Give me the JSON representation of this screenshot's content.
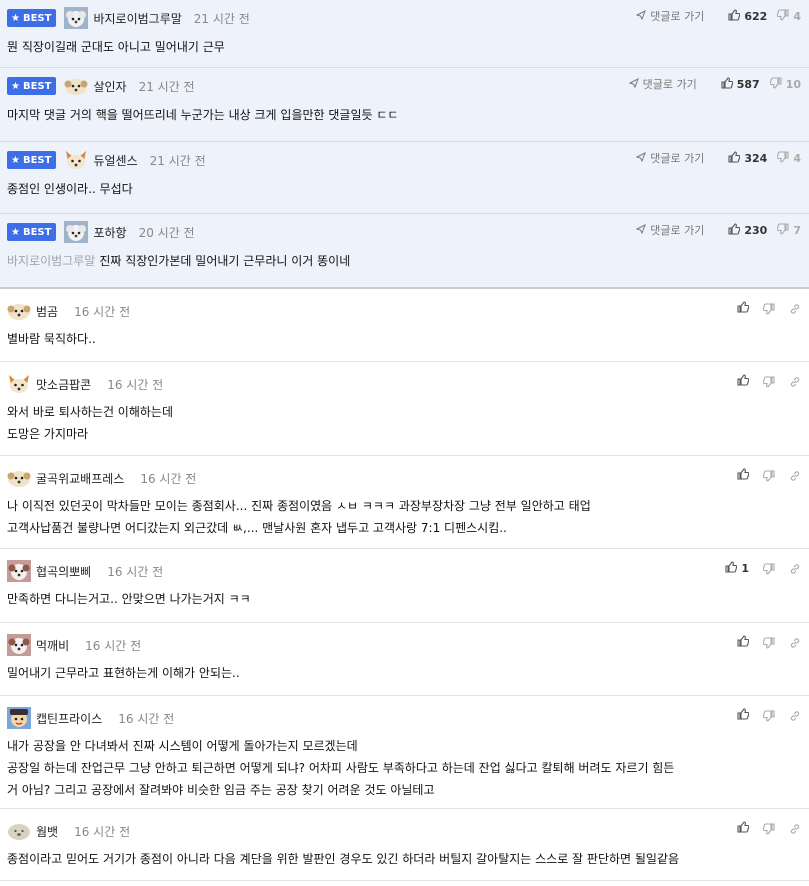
{
  "best_label": "BEST",
  "goto_label": "댓글로 가기",
  "best_comments": [
    {
      "nick": "바지로이범그루말",
      "avatar": "poodle",
      "time": "21 시간 전",
      "text": "뭔 직장이길래 군대도 아니고 밀어내기 근무",
      "reply_to": "",
      "up": "622",
      "down": "4"
    },
    {
      "nick": "살인자",
      "avatar": "beige",
      "time": "21 시간 전",
      "text": "마지막 댓글 거의 핵을 떨어뜨리네 누군가는 내상 크게 입을만한 댓글일듯 ㄷㄷ",
      "reply_to": "",
      "up": "587",
      "down": "10"
    },
    {
      "nick": "듀얼센스",
      "avatar": "fox",
      "time": "21 시간 전",
      "text": "종점인 인생이라.. 무섭다",
      "reply_to": "",
      "up": "324",
      "down": "4"
    },
    {
      "nick": "포하항",
      "avatar": "poodle",
      "time": "20 시간 전",
      "text": "진짜 직장인가본데 밀어내기 근무라니 이거 똥이네",
      "reply_to": "바지로이범그루말",
      "up": "230",
      "down": "7"
    }
  ],
  "comments": [
    {
      "nick": "범곰",
      "avatar": "beige",
      "time": "16 시간 전",
      "lines": [
        "별바람 묵직하다.."
      ],
      "up": ""
    },
    {
      "nick": "맛소금팝콘",
      "avatar": "fox",
      "time": "16 시간 전",
      "lines": [
        "와서 바로 퇴사하는건 이해하는데",
        "도망은 가지마라"
      ],
      "up": ""
    },
    {
      "nick": "굴곡위교배프레스",
      "avatar": "beige",
      "time": "16 시간 전",
      "lines": [
        "나 이직전 있던곳이 막차들만 모이는 종점회사... 진짜 종점이였음 ㅅㅂ ㅋㅋㅋ 과장부장차장 그냥 전부 일안하고 태업",
        "고객사납품건 불량나면 어디갔는지 외근갔데 ㅄ,... 맨날사원 혼자 냅두고 고객사랑 7:1 디펜스시킴.."
      ],
      "up": ""
    },
    {
      "nick": "협곡의뽀삐",
      "avatar": "dog",
      "time": "16 시간 전",
      "lines": [
        "만족하면 다니는거고.. 안맞으면 나가는거지 ㅋㅋ"
      ],
      "up": "1"
    },
    {
      "nick": "먹깨비",
      "avatar": "dog",
      "time": "16 시간 전",
      "lines": [
        "밀어내기 근무라고 표현하는게 이해가 안되는.."
      ],
      "up": ""
    },
    {
      "nick": "캡틴프라이스",
      "avatar": "cartoon",
      "time": "16 시간 전",
      "lines": [
        "내가 공장을 안 다녀봐서 진짜 시스템이 어떻게 돌아가는지 모르겠는데",
        "공장일 하는데 잔업근무 그냥 안하고 퇴근하면 어떻게 되냐? 어차피 사람도 부족하다고 하는데 잔업 싫다고 칼퇴해 버려도 자르기 힘든",
        "거 아님? 그리고 공장에서 잘려봐야 비슷한 임금 주는 공장 찾기 어려운 것도 아닐테고"
      ],
      "up": ""
    },
    {
      "nick": "웜뱃",
      "avatar": "wombat",
      "time": "16 시간 전",
      "lines": [
        "종점이라고 믿어도 거기가 종점이 아니라 다음 계단을 위한 발판인 경우도 있긴 하더라 버틸지 갈아탈지는 스스로 잘 판단하면 될일같음"
      ],
      "up": ""
    }
  ]
}
